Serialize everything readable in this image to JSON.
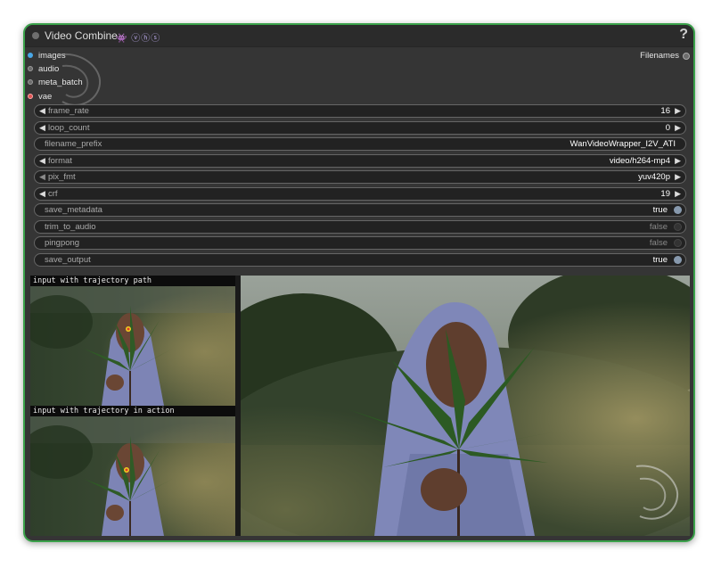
{
  "node": {
    "title": "Video Combine",
    "badges": "👾 ⓥⓗⓢ",
    "help": "?",
    "border_color": "#3aa14a"
  },
  "inputs": [
    {
      "label": "images",
      "color": "#49a8e8"
    },
    {
      "label": "audio",
      "color": "#8a8a8a"
    },
    {
      "label": "meta_batch",
      "color": "#8a8a8a"
    },
    {
      "label": "vae",
      "color": "#e05454"
    }
  ],
  "output": {
    "label": "Filenames"
  },
  "widgets": {
    "frame_rate": {
      "label": "frame_rate",
      "value": "16"
    },
    "loop_count": {
      "label": "loop_count",
      "value": "0"
    },
    "filename_prefix": {
      "label": "filename_prefix",
      "value": "WanVideoWrapper_I2V_ATI"
    },
    "format": {
      "label": "format",
      "value": "video/h264-mp4"
    },
    "pix_fmt": {
      "label": "pix_fmt",
      "value": "yuv420p"
    },
    "crf": {
      "label": "crf",
      "value": "19"
    },
    "save_metadata": {
      "label": "save_metadata",
      "value": "true"
    },
    "trim_to_audio": {
      "label": "trim_to_audio",
      "value": "false"
    },
    "pingpong": {
      "label": "pingpong",
      "value": "false"
    },
    "save_output": {
      "label": "save_output",
      "value": "true"
    }
  },
  "preview": {
    "caption_top": "input with trajectory path",
    "caption_bottom": "input with trajectory in action"
  }
}
